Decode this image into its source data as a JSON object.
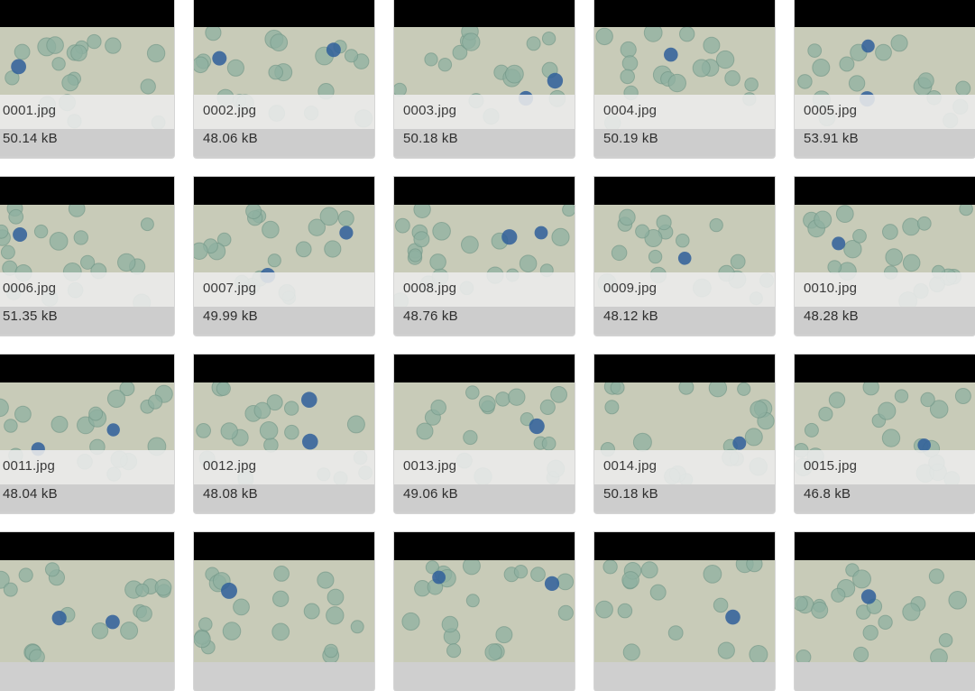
{
  "gallery": {
    "items": [
      {
        "name": "0001.jpg",
        "size": "50.14 kB"
      },
      {
        "name": "0002.jpg",
        "size": "48.06 kB"
      },
      {
        "name": "0003.jpg",
        "size": "50.18 kB"
      },
      {
        "name": "0004.jpg",
        "size": "50.19 kB"
      },
      {
        "name": "0005.jpg",
        "size": "53.91 kB"
      },
      {
        "name": "0006.jpg",
        "size": "51.35 kB"
      },
      {
        "name": "0007.jpg",
        "size": "49.99 kB"
      },
      {
        "name": "0008.jpg",
        "size": "48.76 kB"
      },
      {
        "name": "0009.jpg",
        "size": "48.12 kB"
      },
      {
        "name": "0010.jpg",
        "size": "48.28 kB"
      },
      {
        "name": "0011.jpg",
        "size": "48.04 kB"
      },
      {
        "name": "0012.jpg",
        "size": "48.08 kB"
      },
      {
        "name": "0013.jpg",
        "size": "49.06 kB"
      },
      {
        "name": "0014.jpg",
        "size": "50.18 kB"
      },
      {
        "name": "0015.jpg",
        "size": "46.8 kB"
      },
      {
        "name": "",
        "size": ""
      },
      {
        "name": "",
        "size": ""
      },
      {
        "name": "",
        "size": ""
      },
      {
        "name": "",
        "size": ""
      },
      {
        "name": "",
        "size": ""
      }
    ]
  },
  "thumbnail": {
    "subject": "blood-smear-cells",
    "colors": {
      "background": "#c8cbb8",
      "cell": "#8fb0a0",
      "stained_cell": "#2f5f9a"
    }
  }
}
